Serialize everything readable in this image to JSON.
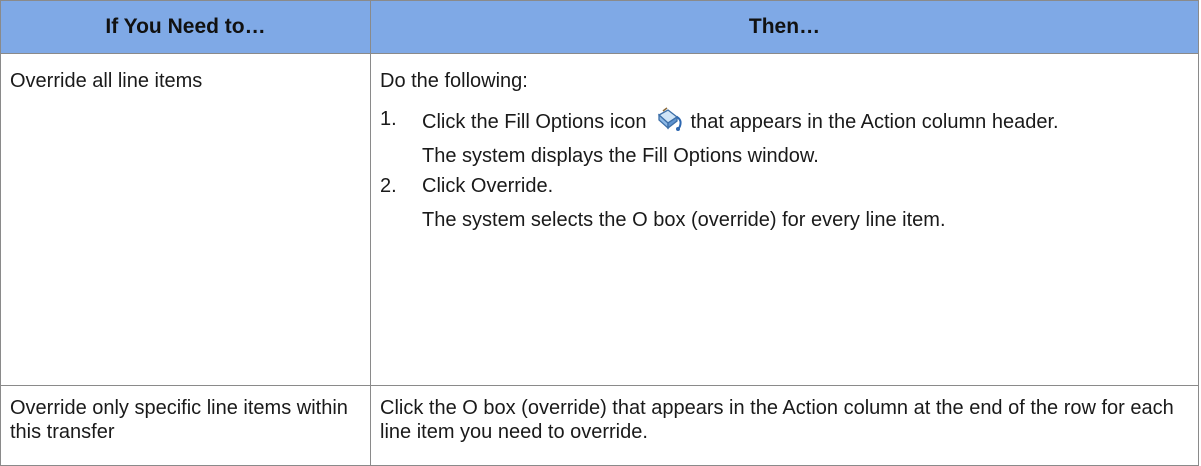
{
  "header": {
    "col1": "If You Need to…",
    "col2": "Then…"
  },
  "rows": [
    {
      "condition": "Override all line items",
      "intro": "Do the following:",
      "steps": [
        {
          "number": "1.",
          "text_before_icon": "Click the Fill Options icon",
          "icon": "fill-options-icon",
          "text_after_icon": "that appears in the Action column header.",
          "result": "The system displays the Fill Options window."
        },
        {
          "number": "2.",
          "text": "Click Override.",
          "result": "The system selects the O box (override) for every line item."
        }
      ]
    },
    {
      "condition": "Override only specific line items within this transfer",
      "action": "Click the O box (override) that appears in the Action column at the end of the row for each line item you need to override."
    }
  ],
  "colors": {
    "header_bg": "#7fa9e6",
    "border": "#8a8a8a"
  }
}
